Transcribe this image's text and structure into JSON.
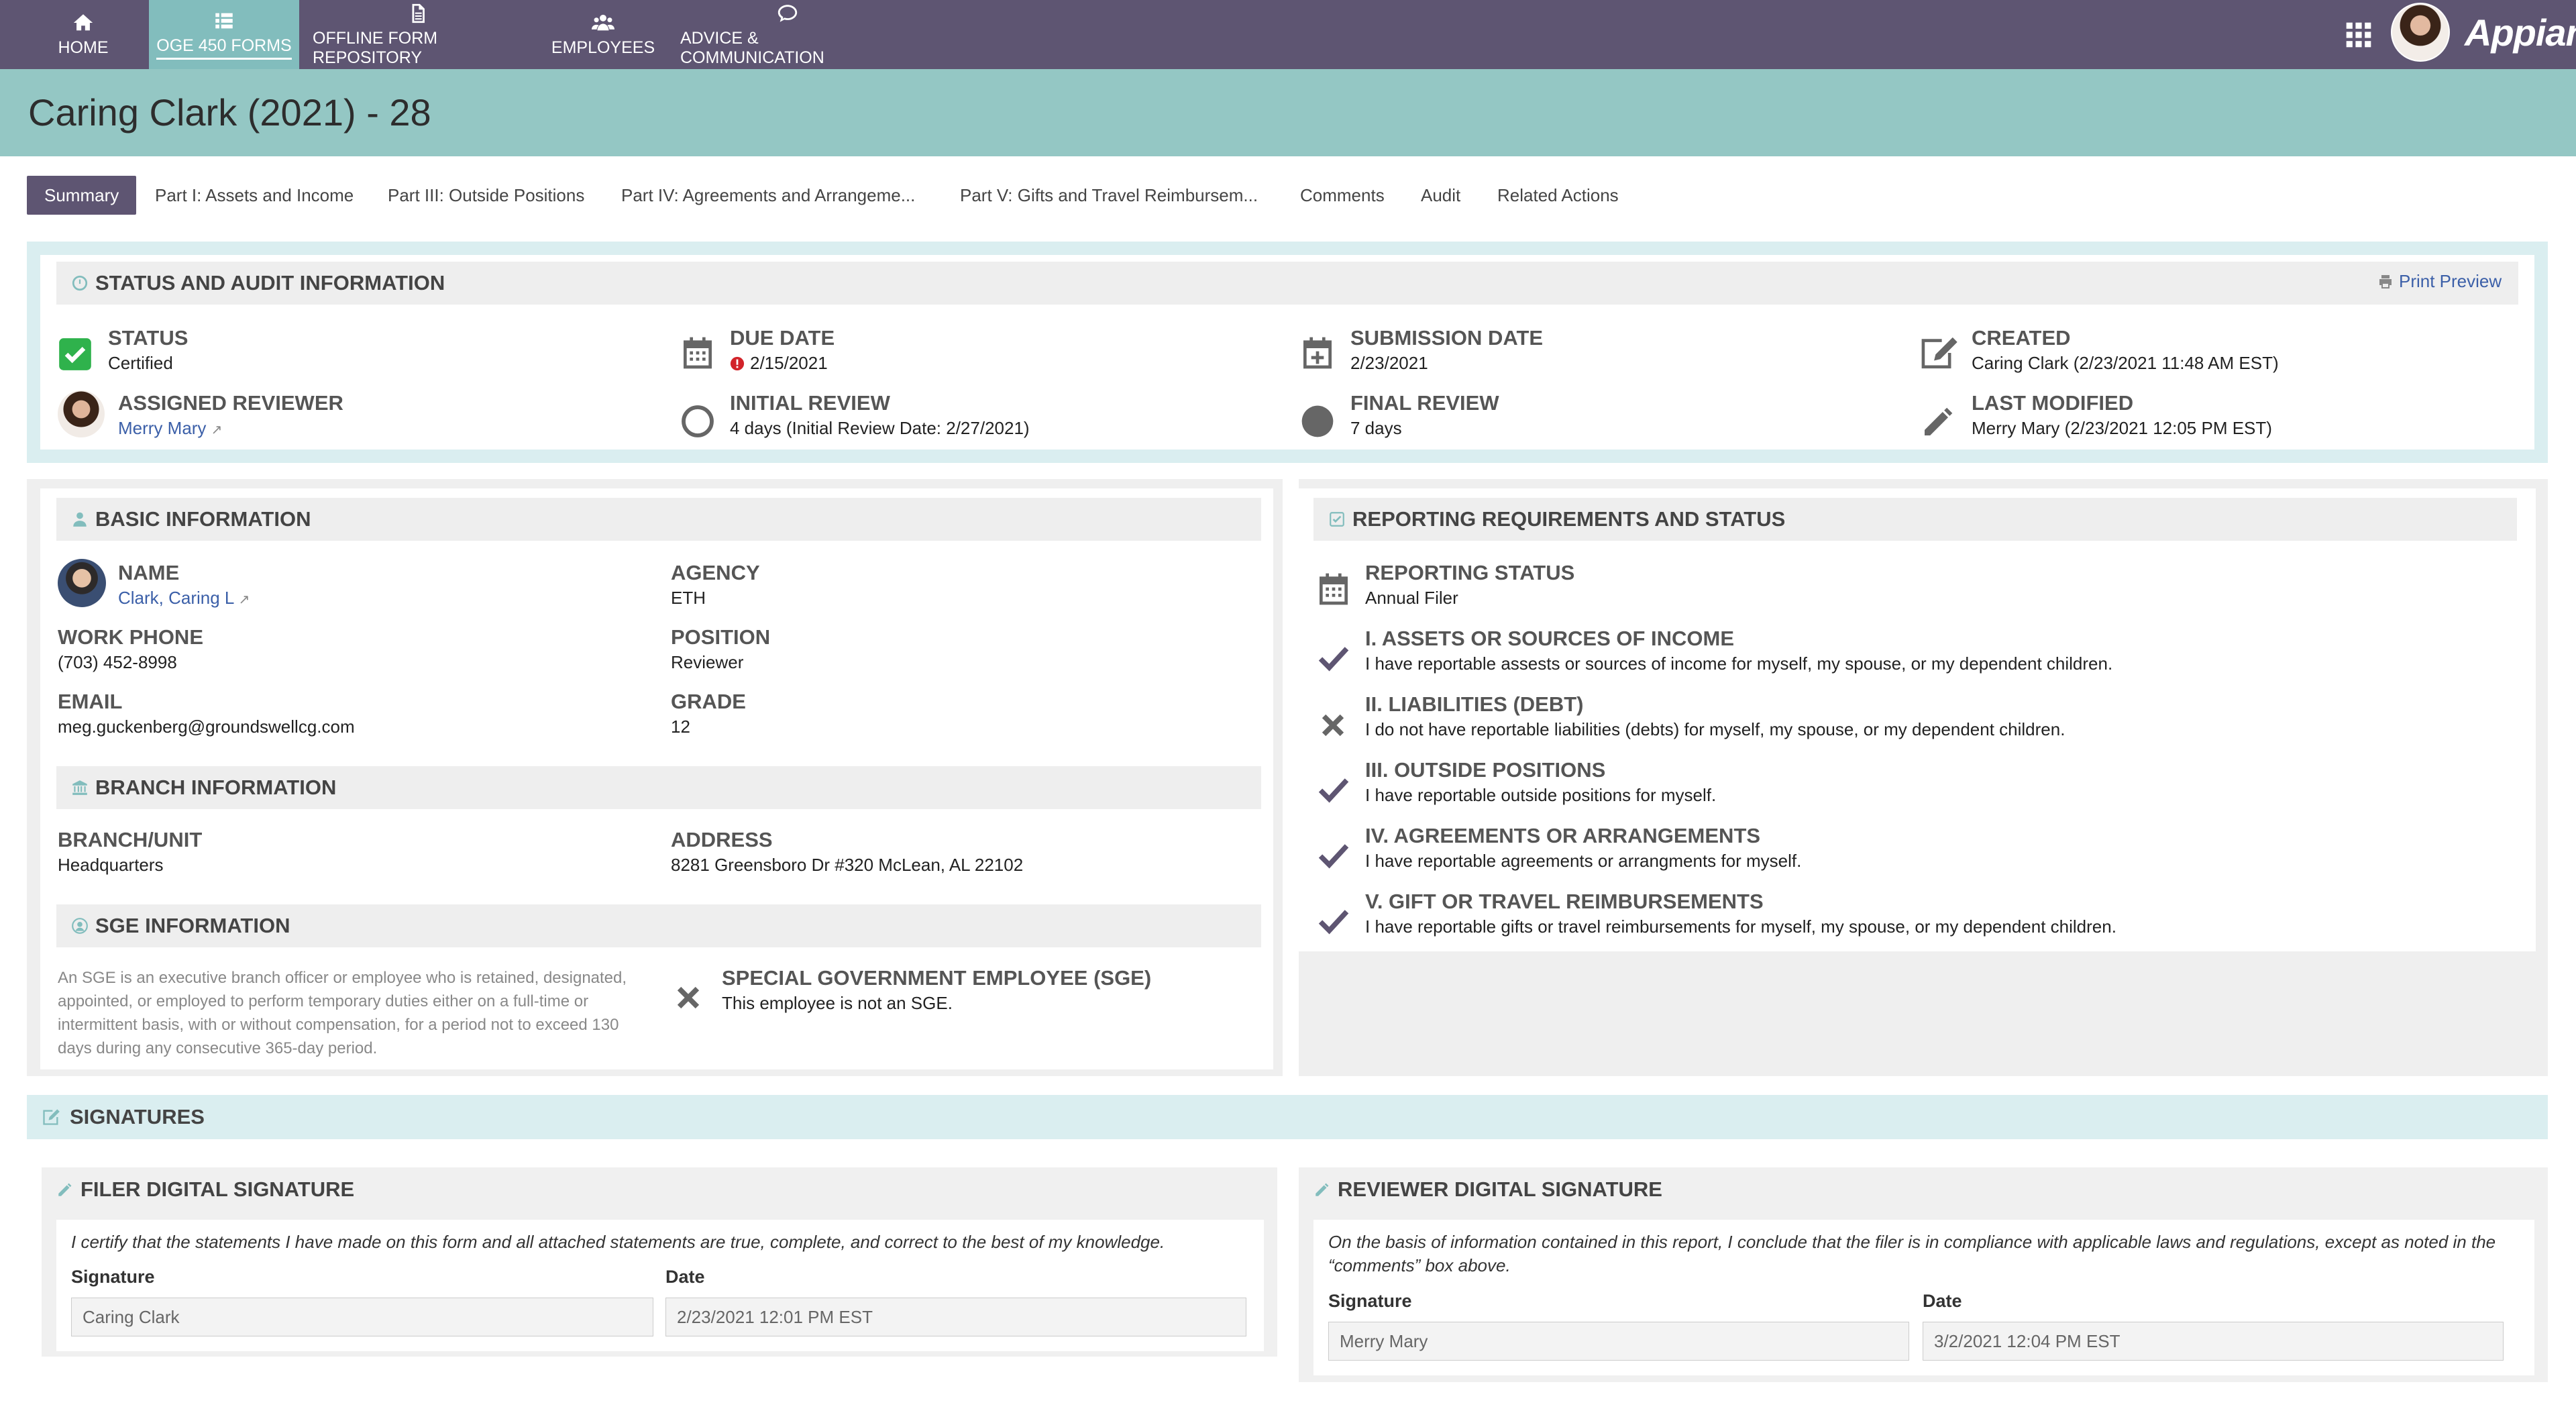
{
  "nav": {
    "items": [
      {
        "label": "HOME",
        "icon": "home-icon"
      },
      {
        "label": "OGE 450 FORMS",
        "icon": "list-icon"
      },
      {
        "label": "OFFLINE FORM REPOSITORY",
        "icon": "document-icon"
      },
      {
        "label": "EMPLOYEES",
        "icon": "people-icon"
      },
      {
        "label": "ADVICE & COMMUNICATION",
        "icon": "chat-icon"
      }
    ],
    "brand": "Appian",
    "colors": {
      "nav_bg": "#5e5572",
      "active_bg": "#82bdbd"
    }
  },
  "page": {
    "title": "Caring Clark (2021) - 28"
  },
  "tabs": [
    "Summary",
    "Part I: Assets and Income",
    "Part III: Outside Positions",
    "Part IV: Agreements and Arrangeme...",
    "Part V: Gifts and Travel Reimbursem...",
    "Comments",
    "Audit",
    "Related Actions"
  ],
  "status": {
    "heading": "STATUS AND AUDIT INFORMATION",
    "print_preview": "Print Preview",
    "status_label": "STATUS",
    "status_value": "Certified",
    "due_label": "DUE DATE",
    "due_value": "2/15/2021",
    "submission_label": "SUBMISSION DATE",
    "submission_value": "2/23/2021",
    "created_label": "CREATED",
    "created_value": "Caring Clark (2/23/2021 11:48 AM EST)",
    "reviewer_label": "ASSIGNED REVIEWER",
    "reviewer_value": "Merry Mary",
    "initial_label": "INITIAL REVIEW",
    "initial_value": "4 days (Initial Review Date: 2/27/2021)",
    "final_label": "FINAL REVIEW",
    "final_value": "7 days",
    "modified_label": "LAST MODIFIED",
    "modified_value": "Merry Mary (2/23/2021 12:05 PM EST)"
  },
  "basic": {
    "heading": "BASIC INFORMATION",
    "name_label": "NAME",
    "name_value": "Clark, Caring L",
    "agency_label": "AGENCY",
    "agency_value": "ETH",
    "phone_label": "WORK PHONE",
    "phone_value": "(703) 452-8998",
    "position_label": "POSITION",
    "position_value": "Reviewer",
    "email_label": "EMAIL",
    "email_value": "meg.guckenberg@groundswellcg.com",
    "grade_label": "GRADE",
    "grade_value": "12"
  },
  "branch": {
    "heading": "BRANCH INFORMATION",
    "unit_label": "BRANCH/UNIT",
    "unit_value": "Headquarters",
    "address_label": "ADDRESS",
    "address_value": "8281 Greensboro Dr #320 McLean, AL 22102"
  },
  "sge": {
    "heading": "SGE INFORMATION",
    "description": "An SGE is an executive branch officer or employee who is retained, designated, appointed, or employed to perform temporary duties either on a full-time or intermittent basis, with or without compensation, for a period not to exceed 130 days during any consecutive 365-day period.",
    "label": "SPECIAL GOVERNMENT EMPLOYEE (SGE)",
    "value": "This employee is not an SGE."
  },
  "reporting": {
    "heading": "REPORTING REQUIREMENTS AND STATUS",
    "status_label": "REPORTING STATUS",
    "status_value": "Annual Filer",
    "items": [
      {
        "title": "I. ASSETS OR SOURCES OF INCOME",
        "text": "I have reportable assests or sources of income for myself, my spouse, or my dependent children.",
        "icon": "check-icon"
      },
      {
        "title": "II. LIABILITIES (DEBT)",
        "text": "I do not have reportable liabilities (debts) for myself, my spouse, or my dependent children.",
        "icon": "x-icon"
      },
      {
        "title": "III. OUTSIDE POSITIONS",
        "text": "I have reportable outside positions for myself.",
        "icon": "check-icon"
      },
      {
        "title": "IV. AGREEMENTS OR ARRANGEMENTS",
        "text": "I have reportable agreements or arrangments for myself.",
        "icon": "check-icon"
      },
      {
        "title": "V. GIFT OR TRAVEL REIMBURSEMENTS",
        "text": "I have reportable gifts or travel reimbursements for myself, my spouse, or my dependent children.",
        "icon": "check-icon"
      }
    ]
  },
  "signatures": {
    "heading": "SIGNATURES",
    "filer": {
      "heading": "FILER DIGITAL SIGNATURE",
      "statement": "I certify that the statements I have made on this form and all attached statements are true, complete, and correct to the best of my knowledge.",
      "sig_label": "Signature",
      "sig_value": "Caring Clark",
      "date_label": "Date",
      "date_value": "2/23/2021 12:01 PM EST"
    },
    "reviewer": {
      "heading": "REVIEWER DIGITAL SIGNATURE",
      "statement": "On the basis of information contained in this report, I conclude that the filer is in compliance with applicable laws and regulations, except as noted in the “comments” box above.",
      "sig_label": "Signature",
      "sig_value": "Merry Mary",
      "date_label": "Date",
      "date_value": "3/2/2021 12:04 PM EST"
    }
  }
}
